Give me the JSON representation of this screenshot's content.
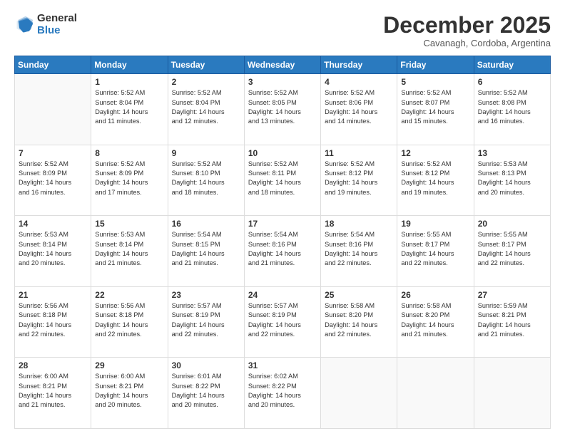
{
  "logo": {
    "general": "General",
    "blue": "Blue"
  },
  "header": {
    "month": "December 2025",
    "location": "Cavanagh, Cordoba, Argentina"
  },
  "days_of_week": [
    "Sunday",
    "Monday",
    "Tuesday",
    "Wednesday",
    "Thursday",
    "Friday",
    "Saturday"
  ],
  "weeks": [
    [
      {
        "day": "",
        "info": ""
      },
      {
        "day": "1",
        "info": "Sunrise: 5:52 AM\nSunset: 8:04 PM\nDaylight: 14 hours\nand 11 minutes."
      },
      {
        "day": "2",
        "info": "Sunrise: 5:52 AM\nSunset: 8:04 PM\nDaylight: 14 hours\nand 12 minutes."
      },
      {
        "day": "3",
        "info": "Sunrise: 5:52 AM\nSunset: 8:05 PM\nDaylight: 14 hours\nand 13 minutes."
      },
      {
        "day": "4",
        "info": "Sunrise: 5:52 AM\nSunset: 8:06 PM\nDaylight: 14 hours\nand 14 minutes."
      },
      {
        "day": "5",
        "info": "Sunrise: 5:52 AM\nSunset: 8:07 PM\nDaylight: 14 hours\nand 15 minutes."
      },
      {
        "day": "6",
        "info": "Sunrise: 5:52 AM\nSunset: 8:08 PM\nDaylight: 14 hours\nand 16 minutes."
      }
    ],
    [
      {
        "day": "7",
        "info": "Sunrise: 5:52 AM\nSunset: 8:09 PM\nDaylight: 14 hours\nand 16 minutes."
      },
      {
        "day": "8",
        "info": "Sunrise: 5:52 AM\nSunset: 8:09 PM\nDaylight: 14 hours\nand 17 minutes."
      },
      {
        "day": "9",
        "info": "Sunrise: 5:52 AM\nSunset: 8:10 PM\nDaylight: 14 hours\nand 18 minutes."
      },
      {
        "day": "10",
        "info": "Sunrise: 5:52 AM\nSunset: 8:11 PM\nDaylight: 14 hours\nand 18 minutes."
      },
      {
        "day": "11",
        "info": "Sunrise: 5:52 AM\nSunset: 8:12 PM\nDaylight: 14 hours\nand 19 minutes."
      },
      {
        "day": "12",
        "info": "Sunrise: 5:52 AM\nSunset: 8:12 PM\nDaylight: 14 hours\nand 19 minutes."
      },
      {
        "day": "13",
        "info": "Sunrise: 5:53 AM\nSunset: 8:13 PM\nDaylight: 14 hours\nand 20 minutes."
      }
    ],
    [
      {
        "day": "14",
        "info": "Sunrise: 5:53 AM\nSunset: 8:14 PM\nDaylight: 14 hours\nand 20 minutes."
      },
      {
        "day": "15",
        "info": "Sunrise: 5:53 AM\nSunset: 8:14 PM\nDaylight: 14 hours\nand 21 minutes."
      },
      {
        "day": "16",
        "info": "Sunrise: 5:54 AM\nSunset: 8:15 PM\nDaylight: 14 hours\nand 21 minutes."
      },
      {
        "day": "17",
        "info": "Sunrise: 5:54 AM\nSunset: 8:16 PM\nDaylight: 14 hours\nand 21 minutes."
      },
      {
        "day": "18",
        "info": "Sunrise: 5:54 AM\nSunset: 8:16 PM\nDaylight: 14 hours\nand 22 minutes."
      },
      {
        "day": "19",
        "info": "Sunrise: 5:55 AM\nSunset: 8:17 PM\nDaylight: 14 hours\nand 22 minutes."
      },
      {
        "day": "20",
        "info": "Sunrise: 5:55 AM\nSunset: 8:17 PM\nDaylight: 14 hours\nand 22 minutes."
      }
    ],
    [
      {
        "day": "21",
        "info": "Sunrise: 5:56 AM\nSunset: 8:18 PM\nDaylight: 14 hours\nand 22 minutes."
      },
      {
        "day": "22",
        "info": "Sunrise: 5:56 AM\nSunset: 8:18 PM\nDaylight: 14 hours\nand 22 minutes."
      },
      {
        "day": "23",
        "info": "Sunrise: 5:57 AM\nSunset: 8:19 PM\nDaylight: 14 hours\nand 22 minutes."
      },
      {
        "day": "24",
        "info": "Sunrise: 5:57 AM\nSunset: 8:19 PM\nDaylight: 14 hours\nand 22 minutes."
      },
      {
        "day": "25",
        "info": "Sunrise: 5:58 AM\nSunset: 8:20 PM\nDaylight: 14 hours\nand 22 minutes."
      },
      {
        "day": "26",
        "info": "Sunrise: 5:58 AM\nSunset: 8:20 PM\nDaylight: 14 hours\nand 21 minutes."
      },
      {
        "day": "27",
        "info": "Sunrise: 5:59 AM\nSunset: 8:21 PM\nDaylight: 14 hours\nand 21 minutes."
      }
    ],
    [
      {
        "day": "28",
        "info": "Sunrise: 6:00 AM\nSunset: 8:21 PM\nDaylight: 14 hours\nand 21 minutes."
      },
      {
        "day": "29",
        "info": "Sunrise: 6:00 AM\nSunset: 8:21 PM\nDaylight: 14 hours\nand 20 minutes."
      },
      {
        "day": "30",
        "info": "Sunrise: 6:01 AM\nSunset: 8:22 PM\nDaylight: 14 hours\nand 20 minutes."
      },
      {
        "day": "31",
        "info": "Sunrise: 6:02 AM\nSunset: 8:22 PM\nDaylight: 14 hours\nand 20 minutes."
      },
      {
        "day": "",
        "info": ""
      },
      {
        "day": "",
        "info": ""
      },
      {
        "day": "",
        "info": ""
      }
    ]
  ]
}
